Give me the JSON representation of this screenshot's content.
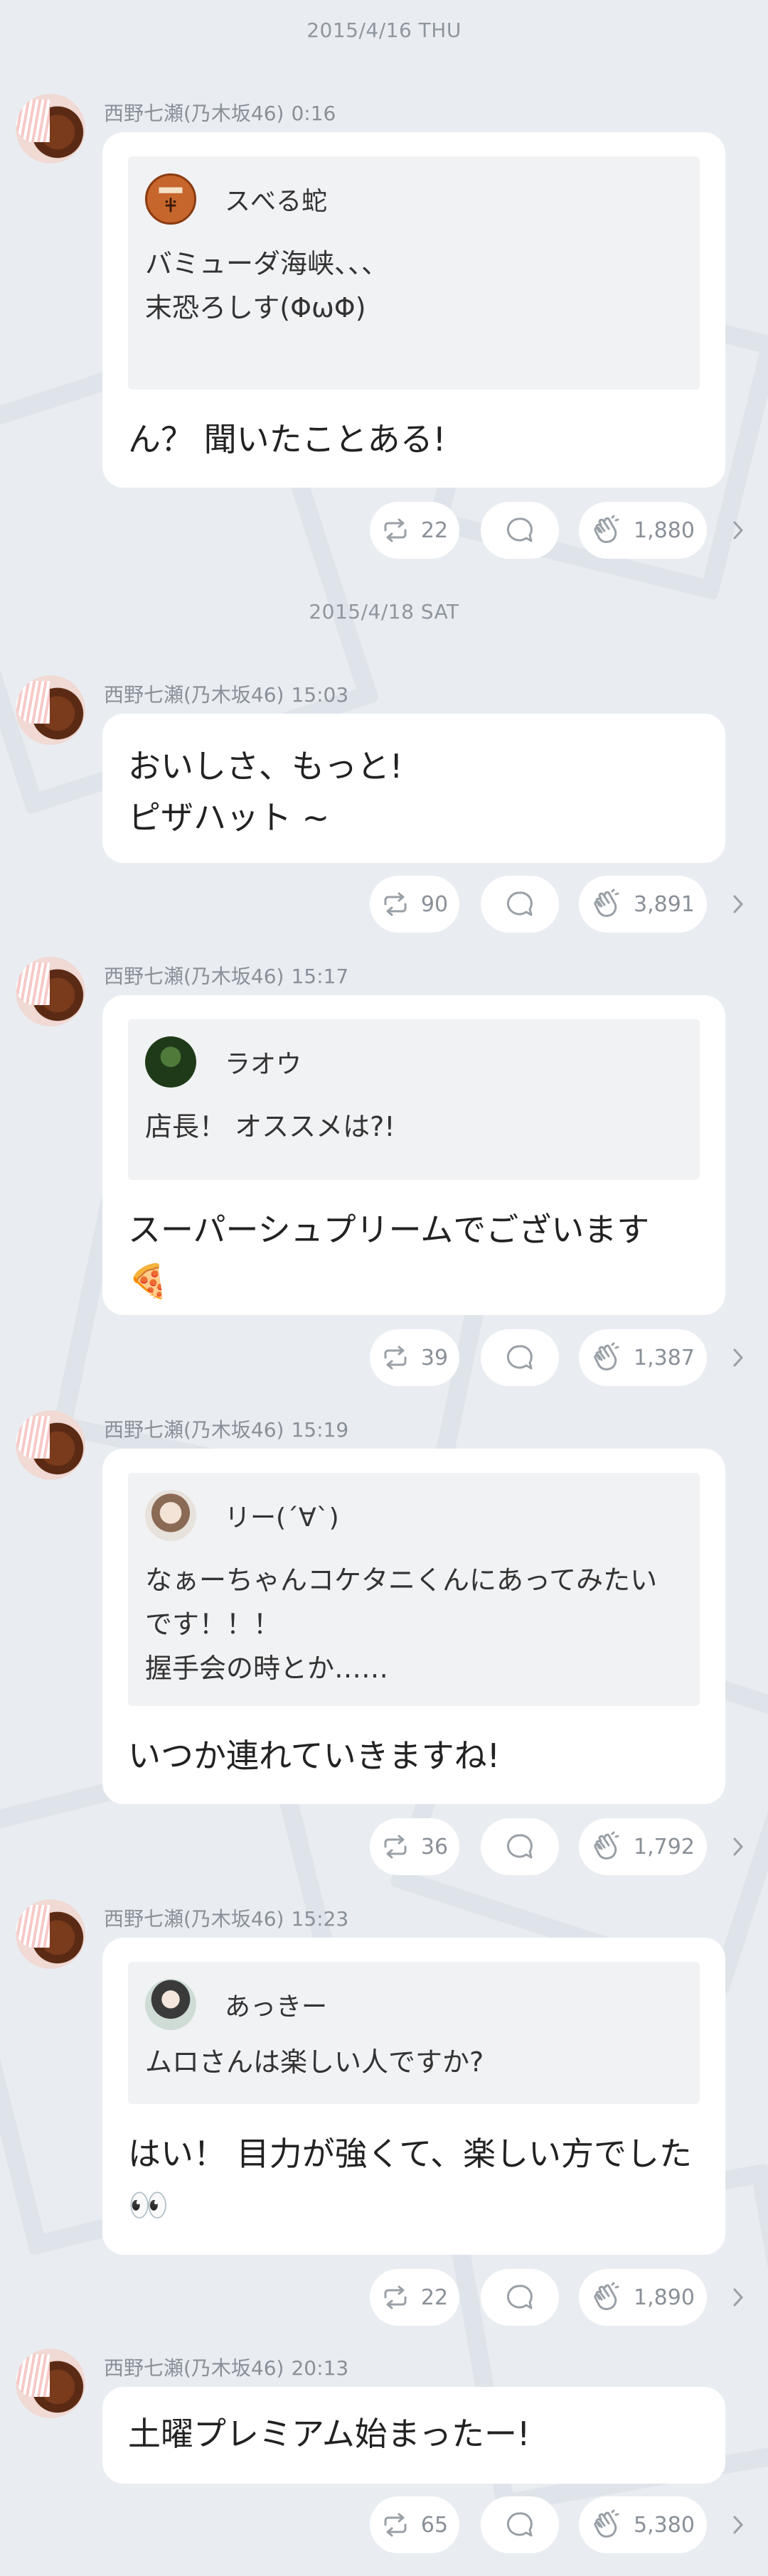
{
  "colors": {
    "background": "#e9edf2",
    "bubble": "#ffffff",
    "quote": "#f1f2f4",
    "meta": "#8a9098"
  },
  "icons": {
    "retweet": "repeat-icon",
    "comment": "speech-bubble-icon",
    "clap": "clapping-hand-icon",
    "more": "chevron-right-icon"
  },
  "dates": [
    "2015/4/16 THU",
    "2015/4/18 SAT"
  ],
  "posts": [
    {
      "author": "西野七瀬(乃木坂46)",
      "time": "0:16",
      "quote": {
        "name": "スべる蛇",
        "text": "バミューダ海峡、、、\n末恐ろしす(ΦωΦ)"
      },
      "body": "ん？ 聞いたことある!",
      "retweets": "22",
      "claps": "1,880"
    },
    {
      "author": "西野七瀬(乃木坂46)",
      "time": "15:03",
      "body": "おいしさ、もっと!\nピザハット ~",
      "retweets": "90",
      "claps": "3,891"
    },
    {
      "author": "西野七瀬(乃木坂46)",
      "time": "15:17",
      "quote": {
        "name": "ラオウ",
        "text": "店長！ オススメは?!"
      },
      "body": "スーパーシュプリームでございます\n🍕",
      "retweets": "39",
      "claps": "1,387"
    },
    {
      "author": "西野七瀬(乃木坂46)",
      "time": "15:19",
      "quote": {
        "name": "リー(´∀`)",
        "text": "なぁーちゃんコケタニくんにあってみたいです！！！\n握手会の時とか……"
      },
      "body": "いつか連れていきますね!",
      "retweets": "36",
      "claps": "1,792"
    },
    {
      "author": "西野七瀬(乃木坂46)",
      "time": "15:23",
      "quote": {
        "name": "あっきー",
        "text": "ムロさんは楽しい人ですか?"
      },
      "body": "はい！ 目力が強くて、楽しい方でした👀",
      "retweets": "22",
      "claps": "1,890"
    },
    {
      "author": "西野七瀬(乃木坂46)",
      "time": "20:13",
      "body": "土曜プレミアム始まったー!",
      "retweets": "65",
      "claps": "5,380"
    }
  ]
}
